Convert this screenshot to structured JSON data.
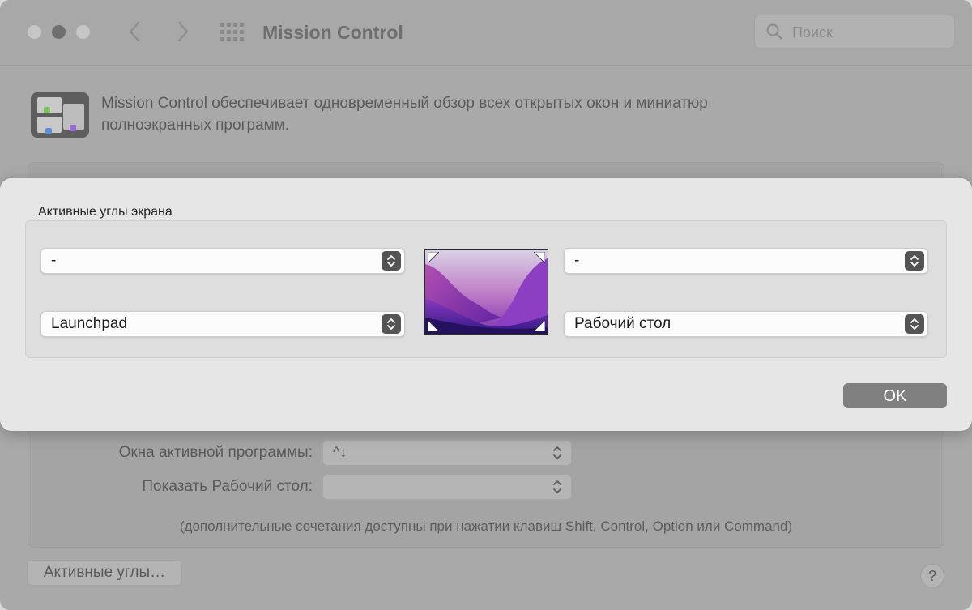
{
  "window": {
    "title": "Mission Control",
    "search_placeholder": "Поиск"
  },
  "main": {
    "description": "Mission Control обеспечивает одновременный обзор всех открытых окон и миниатюр полноэкранных программ.",
    "rows": [
      {
        "label": "Окна активной программы:",
        "value": "^↓"
      },
      {
        "label": "Показать Рабочий стол:",
        "value": ""
      }
    ],
    "hint": "(дополнительные сочетания доступны при нажатии клавиш Shift, Control, Option или Command)",
    "hot_corners_button": "Активные углы…",
    "help_label": "?"
  },
  "sheet": {
    "title": "Активные углы экрана",
    "top_left": "-",
    "top_right": "-",
    "bottom_left": "Launchpad",
    "bottom_right": "Рабочий стол",
    "ok_label": "OK"
  },
  "colors": {
    "ok_button": "#808080",
    "stepper": "#545454",
    "wallpaper_top": "#c9c4de",
    "wallpaper_bottom": "#3b1a8a"
  }
}
